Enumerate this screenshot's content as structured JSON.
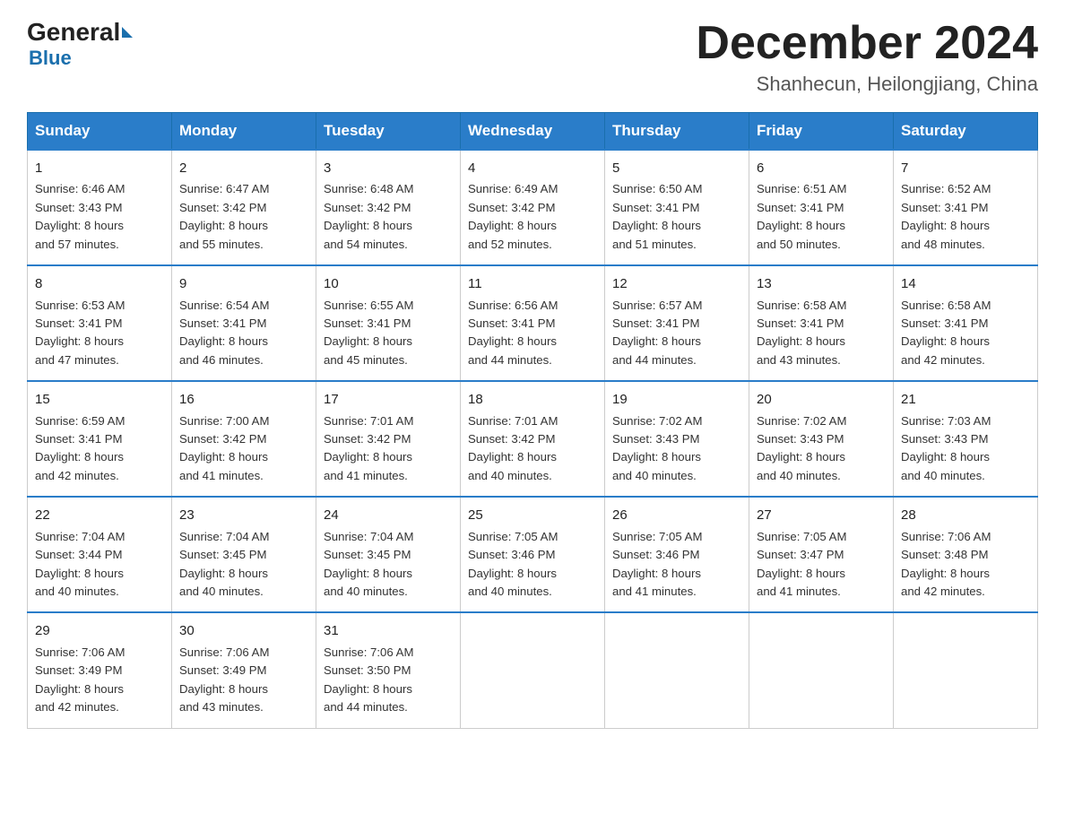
{
  "header": {
    "logo_general": "General",
    "logo_arrow": "",
    "logo_blue": "Blue",
    "month_title": "December 2024",
    "location": "Shanhecun, Heilongjiang, China"
  },
  "days_of_week": [
    "Sunday",
    "Monday",
    "Tuesday",
    "Wednesday",
    "Thursday",
    "Friday",
    "Saturday"
  ],
  "weeks": [
    [
      {
        "day": "1",
        "info": "Sunrise: 6:46 AM\nSunset: 3:43 PM\nDaylight: 8 hours\nand 57 minutes."
      },
      {
        "day": "2",
        "info": "Sunrise: 6:47 AM\nSunset: 3:42 PM\nDaylight: 8 hours\nand 55 minutes."
      },
      {
        "day": "3",
        "info": "Sunrise: 6:48 AM\nSunset: 3:42 PM\nDaylight: 8 hours\nand 54 minutes."
      },
      {
        "day": "4",
        "info": "Sunrise: 6:49 AM\nSunset: 3:42 PM\nDaylight: 8 hours\nand 52 minutes."
      },
      {
        "day": "5",
        "info": "Sunrise: 6:50 AM\nSunset: 3:41 PM\nDaylight: 8 hours\nand 51 minutes."
      },
      {
        "day": "6",
        "info": "Sunrise: 6:51 AM\nSunset: 3:41 PM\nDaylight: 8 hours\nand 50 minutes."
      },
      {
        "day": "7",
        "info": "Sunrise: 6:52 AM\nSunset: 3:41 PM\nDaylight: 8 hours\nand 48 minutes."
      }
    ],
    [
      {
        "day": "8",
        "info": "Sunrise: 6:53 AM\nSunset: 3:41 PM\nDaylight: 8 hours\nand 47 minutes."
      },
      {
        "day": "9",
        "info": "Sunrise: 6:54 AM\nSunset: 3:41 PM\nDaylight: 8 hours\nand 46 minutes."
      },
      {
        "day": "10",
        "info": "Sunrise: 6:55 AM\nSunset: 3:41 PM\nDaylight: 8 hours\nand 45 minutes."
      },
      {
        "day": "11",
        "info": "Sunrise: 6:56 AM\nSunset: 3:41 PM\nDaylight: 8 hours\nand 44 minutes."
      },
      {
        "day": "12",
        "info": "Sunrise: 6:57 AM\nSunset: 3:41 PM\nDaylight: 8 hours\nand 44 minutes."
      },
      {
        "day": "13",
        "info": "Sunrise: 6:58 AM\nSunset: 3:41 PM\nDaylight: 8 hours\nand 43 minutes."
      },
      {
        "day": "14",
        "info": "Sunrise: 6:58 AM\nSunset: 3:41 PM\nDaylight: 8 hours\nand 42 minutes."
      }
    ],
    [
      {
        "day": "15",
        "info": "Sunrise: 6:59 AM\nSunset: 3:41 PM\nDaylight: 8 hours\nand 42 minutes."
      },
      {
        "day": "16",
        "info": "Sunrise: 7:00 AM\nSunset: 3:42 PM\nDaylight: 8 hours\nand 41 minutes."
      },
      {
        "day": "17",
        "info": "Sunrise: 7:01 AM\nSunset: 3:42 PM\nDaylight: 8 hours\nand 41 minutes."
      },
      {
        "day": "18",
        "info": "Sunrise: 7:01 AM\nSunset: 3:42 PM\nDaylight: 8 hours\nand 40 minutes."
      },
      {
        "day": "19",
        "info": "Sunrise: 7:02 AM\nSunset: 3:43 PM\nDaylight: 8 hours\nand 40 minutes."
      },
      {
        "day": "20",
        "info": "Sunrise: 7:02 AM\nSunset: 3:43 PM\nDaylight: 8 hours\nand 40 minutes."
      },
      {
        "day": "21",
        "info": "Sunrise: 7:03 AM\nSunset: 3:43 PM\nDaylight: 8 hours\nand 40 minutes."
      }
    ],
    [
      {
        "day": "22",
        "info": "Sunrise: 7:04 AM\nSunset: 3:44 PM\nDaylight: 8 hours\nand 40 minutes."
      },
      {
        "day": "23",
        "info": "Sunrise: 7:04 AM\nSunset: 3:45 PM\nDaylight: 8 hours\nand 40 minutes."
      },
      {
        "day": "24",
        "info": "Sunrise: 7:04 AM\nSunset: 3:45 PM\nDaylight: 8 hours\nand 40 minutes."
      },
      {
        "day": "25",
        "info": "Sunrise: 7:05 AM\nSunset: 3:46 PM\nDaylight: 8 hours\nand 40 minutes."
      },
      {
        "day": "26",
        "info": "Sunrise: 7:05 AM\nSunset: 3:46 PM\nDaylight: 8 hours\nand 41 minutes."
      },
      {
        "day": "27",
        "info": "Sunrise: 7:05 AM\nSunset: 3:47 PM\nDaylight: 8 hours\nand 41 minutes."
      },
      {
        "day": "28",
        "info": "Sunrise: 7:06 AM\nSunset: 3:48 PM\nDaylight: 8 hours\nand 42 minutes."
      }
    ],
    [
      {
        "day": "29",
        "info": "Sunrise: 7:06 AM\nSunset: 3:49 PM\nDaylight: 8 hours\nand 42 minutes."
      },
      {
        "day": "30",
        "info": "Sunrise: 7:06 AM\nSunset: 3:49 PM\nDaylight: 8 hours\nand 43 minutes."
      },
      {
        "day": "31",
        "info": "Sunrise: 7:06 AM\nSunset: 3:50 PM\nDaylight: 8 hours\nand 44 minutes."
      },
      {
        "day": "",
        "info": ""
      },
      {
        "day": "",
        "info": ""
      },
      {
        "day": "",
        "info": ""
      },
      {
        "day": "",
        "info": ""
      }
    ]
  ]
}
